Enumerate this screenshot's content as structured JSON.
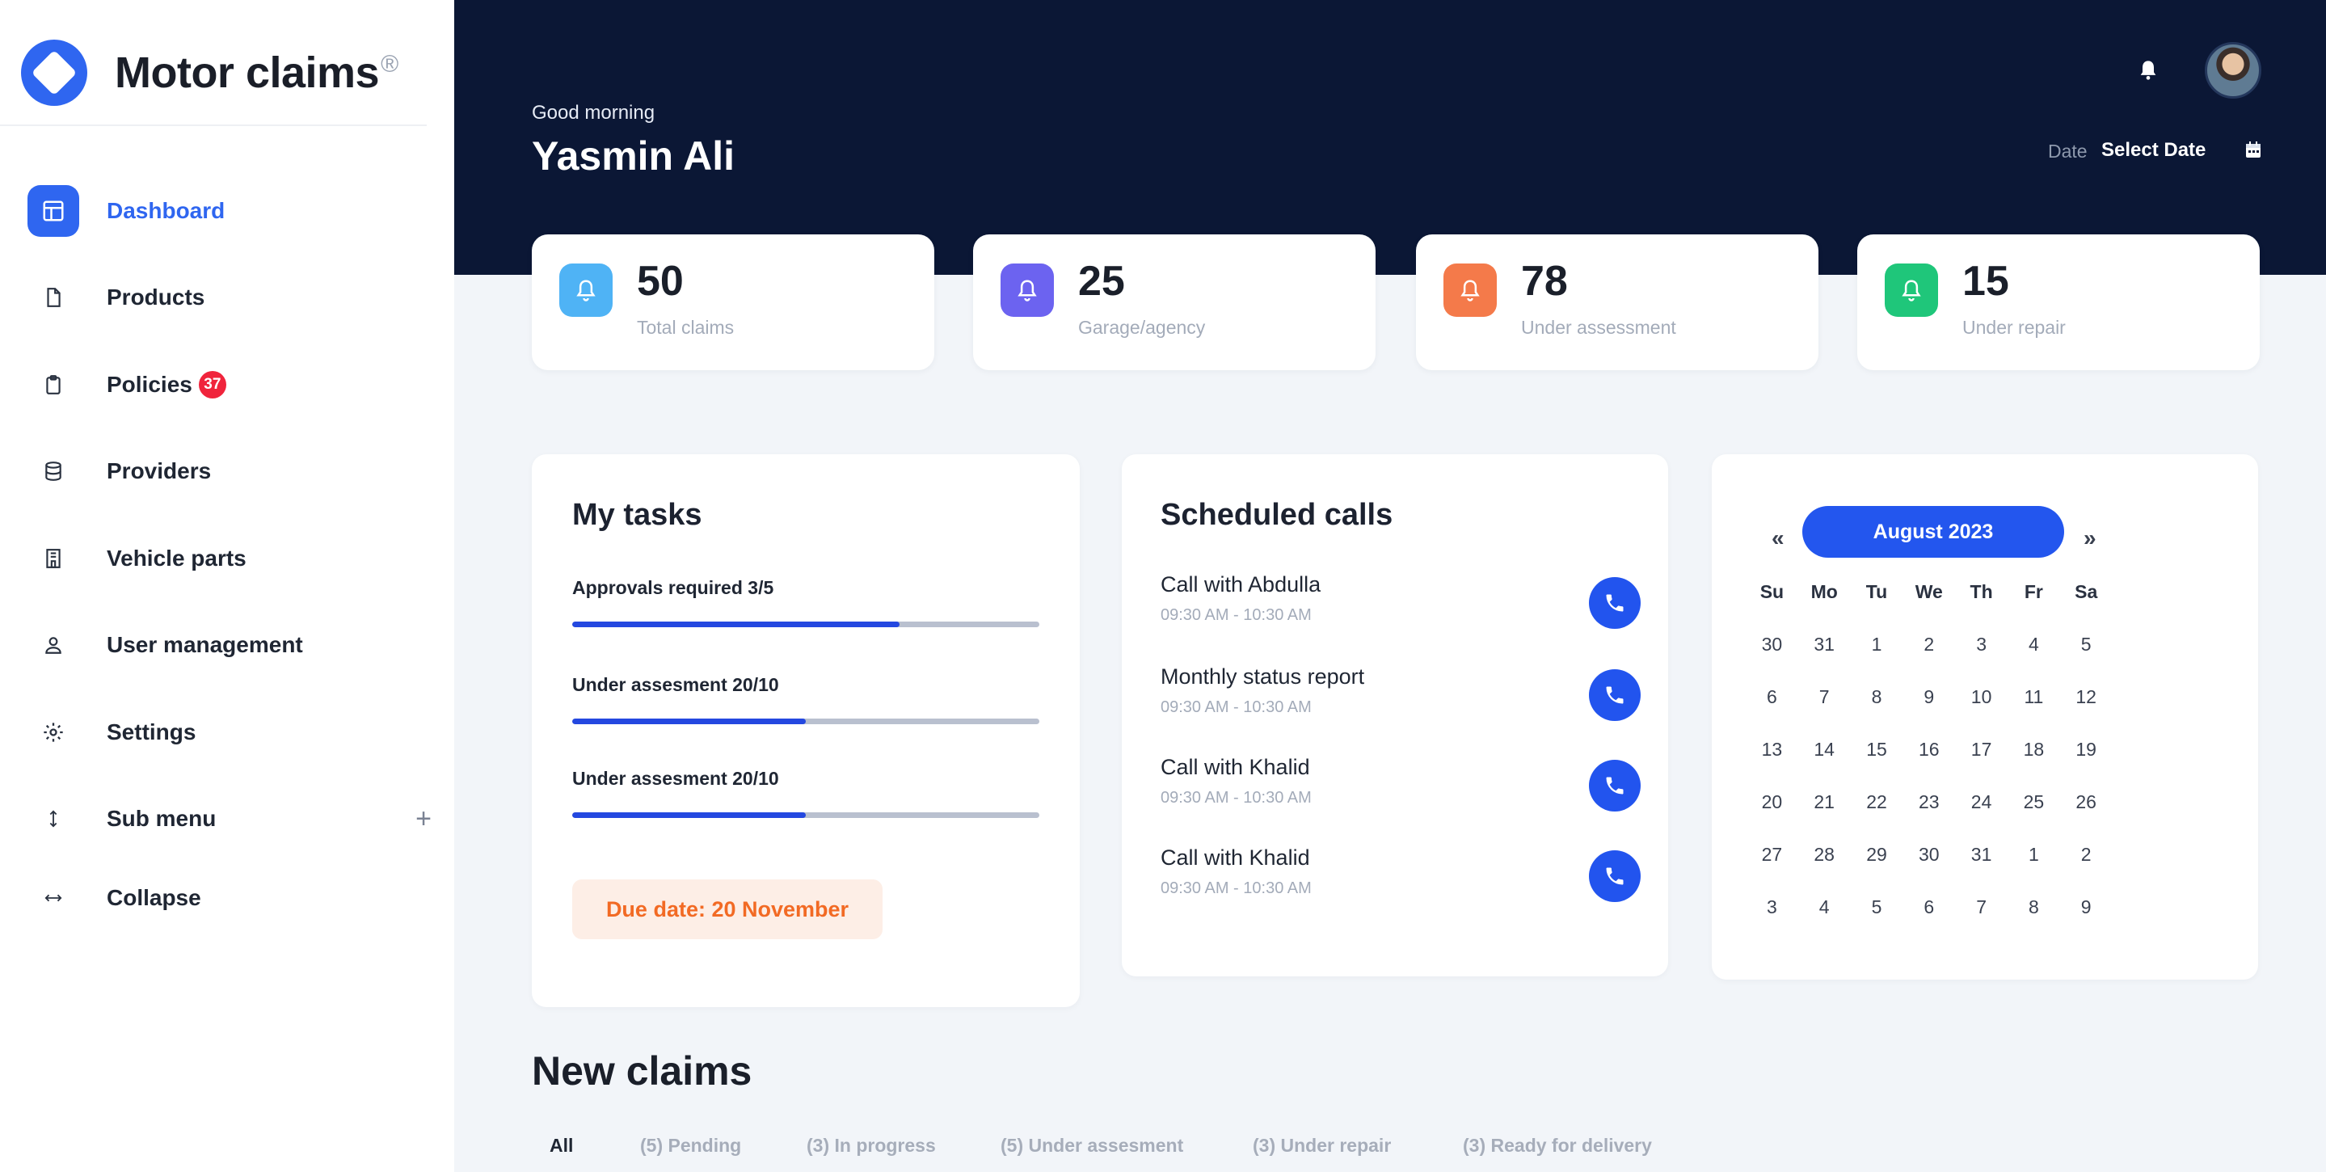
{
  "brand": {
    "name": "Motor claims",
    "reg": "®"
  },
  "sidebar": {
    "items": [
      {
        "label": "Dashboard",
        "icon": "layout-icon",
        "active": true
      },
      {
        "label": "Products",
        "icon": "document-icon"
      },
      {
        "label": "Policies",
        "icon": "clipboard-icon",
        "badge": "37"
      },
      {
        "label": "Providers",
        "icon": "database-icon"
      },
      {
        "label": "Vehicle parts",
        "icon": "building-icon"
      },
      {
        "label": "User management",
        "icon": "user-icon"
      },
      {
        "label": "Settings",
        "icon": "gear-icon"
      },
      {
        "label": "Sub menu",
        "icon": "arrows-vertical-icon",
        "expand": "+"
      },
      {
        "label": "Collapse",
        "icon": "arrows-horizontal-icon"
      }
    ]
  },
  "header": {
    "greeting": "Good morning",
    "user_name": "Yasmin Ali",
    "date_label": "Date",
    "date_value": "Select Date"
  },
  "stats": [
    {
      "value": "50",
      "label": "Total claims",
      "color": "#4fb3f5"
    },
    {
      "value": "25",
      "label": "Garage/agency",
      "color": "#6c63f0"
    },
    {
      "value": "78",
      "label": "Under assessment",
      "color": "#f47a4a"
    },
    {
      "value": "15",
      "label": "Under repair",
      "color": "#1fc67a"
    }
  ],
  "tasks": {
    "title": "My tasks",
    "items": [
      {
        "label": "Approvals required 3/5",
        "progress": 0.7
      },
      {
        "label": "Under assesment 20/10",
        "progress": 0.5
      },
      {
        "label": "Under assesment 20/10",
        "progress": 0.5
      }
    ],
    "due": "Due date: 20 November"
  },
  "calls": {
    "title": "Scheduled calls",
    "items": [
      {
        "title": "Call with Abdulla",
        "time": "09:30 AM - 10:30 AM"
      },
      {
        "title": "Monthly status report",
        "time": "09:30 AM - 10:30 AM"
      },
      {
        "title": "Call with Khalid",
        "time": "09:30 AM - 10:30 AM"
      },
      {
        "title": "Call with Khalid",
        "time": "09:30 AM - 10:30 AM"
      }
    ]
  },
  "calendar": {
    "prev": "«",
    "next": "»",
    "month": "August 2023",
    "weekdays": [
      "Su",
      "Mo",
      "Tu",
      "We",
      "Th",
      "Fr",
      "Sa"
    ],
    "weeks": [
      [
        "30",
        "31",
        "1",
        "2",
        "3",
        "4",
        "5"
      ],
      [
        "6",
        "7",
        "8",
        "9",
        "10",
        "11",
        "12"
      ],
      [
        "13",
        "14",
        "15",
        "16",
        "17",
        "18",
        "19"
      ],
      [
        "20",
        "21",
        "22",
        "23",
        "24",
        "25",
        "26"
      ],
      [
        "27",
        "28",
        "29",
        "30",
        "31",
        "1",
        "2"
      ],
      [
        "3",
        "4",
        "5",
        "6",
        "7",
        "8",
        "9"
      ]
    ]
  },
  "new_claims": {
    "title": "New claims",
    "filters": [
      {
        "label": "All",
        "active": true
      },
      {
        "label": "(5) Pending"
      },
      {
        "label": "(3) In progress"
      },
      {
        "label": "(5) Under assesment"
      },
      {
        "label": "(3) Under repair"
      },
      {
        "label": "(3) Ready for delivery"
      }
    ]
  }
}
